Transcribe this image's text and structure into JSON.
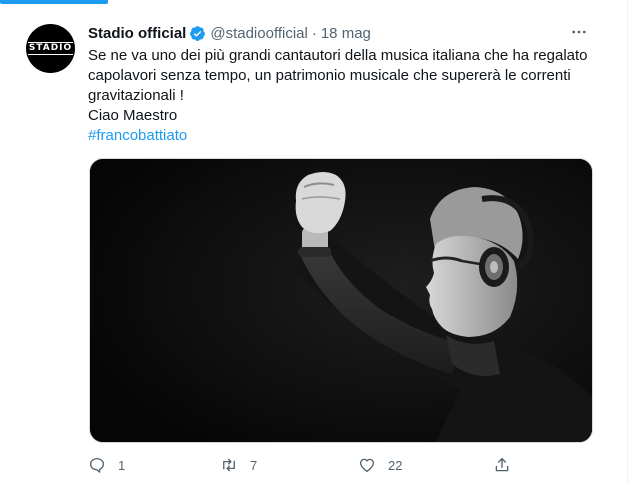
{
  "tweet": {
    "avatar_text": "STADIO",
    "display_name": "Stadio official",
    "handle": "@stadioofficial",
    "separator": "·",
    "date": "18 mag",
    "text_lines": [
      "Se ne va uno dei più grandi cantautori della musica italiana che ha regalato",
      "capolavori senza tempo, un patrimonio musicale che supererà le correnti",
      "gravitazionali !",
      "Ciao Maestro"
    ],
    "hashtag": "#francobattiato",
    "actions": {
      "reply_count": "1",
      "retweet_count": "7",
      "like_count": "22"
    }
  },
  "icons": {
    "verified": "verified-badge-icon",
    "more": "more-options-icon",
    "reply": "reply-icon",
    "retweet": "retweet-icon",
    "like": "heart-icon",
    "share": "share-icon"
  },
  "colors": {
    "accent": "#1d9bf0",
    "text": "#0f1419",
    "secondary_text": "#536471"
  }
}
